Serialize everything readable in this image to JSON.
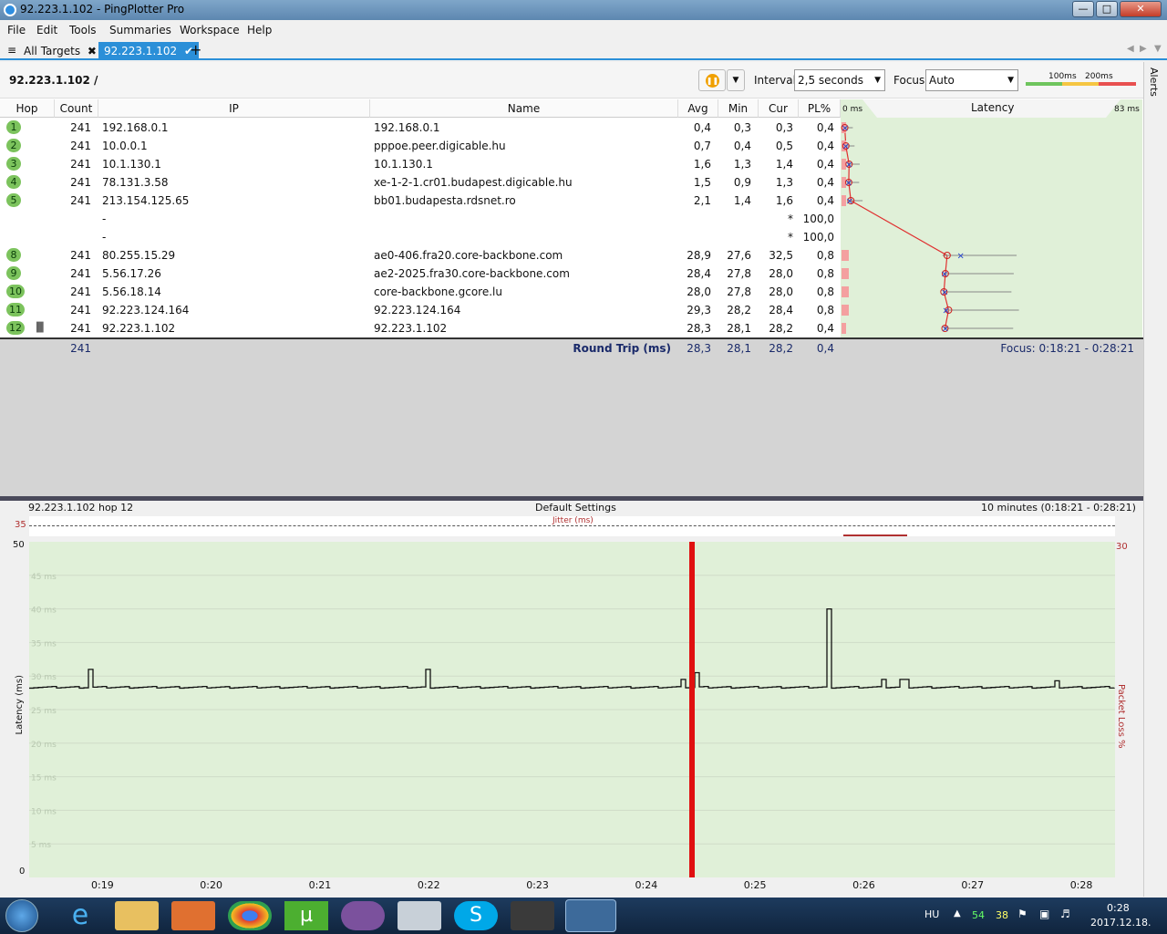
{
  "window": {
    "title": "92.223.1.102 - PingPlotter Pro"
  },
  "menu": [
    "File",
    "Edit",
    "Tools",
    "Summaries",
    "Workspace",
    "Help"
  ],
  "tabs": [
    {
      "label": "All Targets"
    },
    {
      "label": "92.223.1.102"
    }
  ],
  "toolbar": {
    "target_path": "92.223.1.102 /",
    "interval_label": "Interval",
    "interval_value": "2,5 seconds",
    "focus_label": "Focus",
    "focus_value": "Auto",
    "scale_100": "100ms",
    "scale_200": "200ms"
  },
  "alerts_label": "Alerts",
  "columns": {
    "hop": "Hop",
    "count": "Count",
    "ip": "IP",
    "name": "Name",
    "avg": "Avg",
    "min": "Min",
    "cur": "Cur",
    "pl": "PL%",
    "latency": "Latency",
    "lat_min": "0 ms",
    "lat_max": "83 ms"
  },
  "hops": [
    {
      "hop": "1",
      "count": "241",
      "ip": "192.168.0.1",
      "name": "192.168.0.1",
      "avg": "0,4",
      "min": "0,3",
      "cur": "0,3",
      "pl": "0,4"
    },
    {
      "hop": "2",
      "count": "241",
      "ip": "10.0.0.1",
      "name": "pppoe.peer.digicable.hu",
      "avg": "0,7",
      "min": "0,4",
      "cur": "0,5",
      "pl": "0,4"
    },
    {
      "hop": "3",
      "count": "241",
      "ip": "10.1.130.1",
      "name": "10.1.130.1",
      "avg": "1,6",
      "min": "1,3",
      "cur": "1,4",
      "pl": "0,4"
    },
    {
      "hop": "4",
      "count": "241",
      "ip": "78.131.3.58",
      "name": "xe-1-2-1.cr01.budapest.digicable.hu",
      "avg": "1,5",
      "min": "0,9",
      "cur": "1,3",
      "pl": "0,4"
    },
    {
      "hop": "5",
      "count": "241",
      "ip": "213.154.125.65",
      "name": "bb01.budapesta.rdsnet.ro",
      "avg": "2,1",
      "min": "1,4",
      "cur": "1,6",
      "pl": "0,4"
    },
    {
      "hop": "",
      "count": "",
      "ip": "-",
      "name": "",
      "avg": "",
      "min": "",
      "cur": "*",
      "pl": "100,0"
    },
    {
      "hop": "",
      "count": "",
      "ip": "-",
      "name": "",
      "avg": "",
      "min": "",
      "cur": "*",
      "pl": "100,0"
    },
    {
      "hop": "8",
      "count": "241",
      "ip": "80.255.15.29",
      "name": "ae0-406.fra20.core-backbone.com",
      "avg": "28,9",
      "min": "27,6",
      "cur": "32,5",
      "pl": "0,8"
    },
    {
      "hop": "9",
      "count": "241",
      "ip": "5.56.17.26",
      "name": "ae2-2025.fra30.core-backbone.com",
      "avg": "28,4",
      "min": "27,8",
      "cur": "28,0",
      "pl": "0,8"
    },
    {
      "hop": "10",
      "count": "241",
      "ip": "5.56.18.14",
      "name": "core-backbone.gcore.lu",
      "avg": "28,0",
      "min": "27,8",
      "cur": "28,0",
      "pl": "0,8"
    },
    {
      "hop": "11",
      "count": "241",
      "ip": "92.223.124.164",
      "name": "92.223.124.164",
      "avg": "29,3",
      "min": "28,2",
      "cur": "28,4",
      "pl": "0,8"
    },
    {
      "hop": "12",
      "count": "241",
      "ip": "92.223.1.102",
      "name": "92.223.1.102",
      "avg": "28,3",
      "min": "28,1",
      "cur": "28,2",
      "pl": "0,4"
    }
  ],
  "summary": {
    "count": "241",
    "label": "Round Trip (ms)",
    "avg": "28,3",
    "min": "28,1",
    "cur": "28,2",
    "pl": "0,4",
    "focus": "Focus: 0:18:21 - 0:28:21"
  },
  "graph": {
    "header_left": "92.223.1.102 hop 12",
    "header_center": "Default Settings",
    "header_right": "10 minutes (0:18:21 - 0:28:21)",
    "jitter_label": "Jitter (ms)",
    "jitter_max": "35",
    "y_max": "50",
    "y_min": "0",
    "pl_max": "30",
    "y_axis_label": "Latency (ms)",
    "pl_axis_label": "Packet Loss %",
    "grid_labels": [
      "45 ms",
      "40 ms",
      "35 ms",
      "30 ms",
      "25 ms",
      "20 ms",
      "15 ms",
      "10 ms",
      "5 ms"
    ],
    "x_labels": [
      "0:19",
      "0:20",
      "0:21",
      "0:22",
      "0:23",
      "0:24",
      "0:25",
      "0:26",
      "0:27",
      "0:28"
    ]
  },
  "taskbar": {
    "lang": "HU",
    "tray_1": "54",
    "tray_2": "38",
    "time": "0:28",
    "date": "2017.12.18."
  }
}
